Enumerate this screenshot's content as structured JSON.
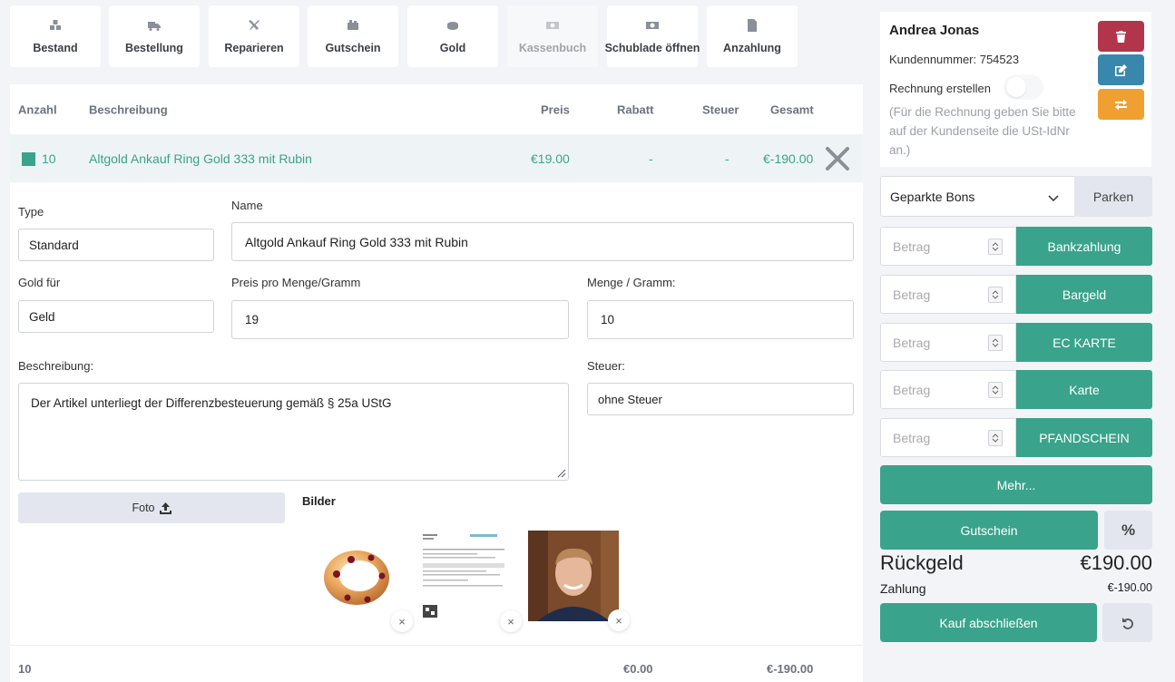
{
  "toolbar": [
    {
      "label": "Bestand",
      "icon": "boxes-icon",
      "disabled": false
    },
    {
      "label": "Bestellung",
      "icon": "truck-icon",
      "disabled": false
    },
    {
      "label": "Reparieren",
      "icon": "tools-icon",
      "disabled": false
    },
    {
      "label": "Gutschein",
      "icon": "voucher-icon",
      "disabled": false
    },
    {
      "label": "Gold",
      "icon": "gold-icon",
      "disabled": false
    },
    {
      "label": "Kassenbuch",
      "icon": "money-icon",
      "disabled": true
    },
    {
      "label": "Schublade öffnen",
      "icon": "money-icon",
      "disabled": false
    },
    {
      "label": "Anzahlung",
      "icon": "invoice-icon",
      "disabled": false
    }
  ],
  "table": {
    "headers": {
      "anzahl": "Anzahl",
      "beschreibung": "Beschreibung",
      "preis": "Preis",
      "rabatt": "Rabatt",
      "steuer": "Steuer",
      "gesamt": "Gesamt"
    },
    "row": {
      "anzahl": "10",
      "beschreibung": "Altgold Ankauf Ring Gold 333 mit Rubin",
      "preis": "€19.00",
      "rabatt": "-",
      "steuer": "-",
      "gesamt": "€-190.00"
    }
  },
  "form": {
    "type_label": "Type",
    "type_value": "Standard",
    "name_label": "Name",
    "name_value": "Altgold Ankauf Ring Gold 333 mit Rubin",
    "goldfuer_label": "Gold für",
    "goldfuer_value": "Geld",
    "preis_label": "Preis pro Menge/Gramm",
    "preis_value": "19",
    "menge_label": "Menge / Gramm:",
    "menge_value": "10",
    "beschreibung_label": "Beschreibung:",
    "beschreibung_value": "Der Artikel unterliegt der Differenzbesteuerung gemäß § 25a UStG",
    "steuer_label": "Steuer:",
    "steuer_value": "ohne Steuer",
    "foto_label": "Foto",
    "bilder_label": "Bilder",
    "remove_symbol": "×"
  },
  "footer": {
    "anzahl": "10",
    "rabatt": "€0.00",
    "gesamt": "€-190.00"
  },
  "customer": {
    "name": "Andrea Jonas",
    "number": "Kundennummer: 754523",
    "rechnung_label": "Rechnung erstellen",
    "note": "(Für die Rechnung geben Sie bitte auf der Kundenseite die USt-IdNr an.)",
    "colors": {
      "delete": "#b3354b",
      "edit": "#3a87ad",
      "switch": "#f0a030"
    }
  },
  "parked": {
    "select_value": "Geparkte Bons",
    "button": "Parken"
  },
  "payments": [
    {
      "placeholder": "Betrag",
      "label": "Bankzahlung"
    },
    {
      "placeholder": "Betrag",
      "label": "Bargeld"
    },
    {
      "placeholder": "Betrag",
      "label": "EC KARTE"
    },
    {
      "placeholder": "Betrag",
      "label": "Karte"
    },
    {
      "placeholder": "Betrag",
      "label": "PFANDSCHEIN"
    }
  ],
  "more_label": "Mehr...",
  "gutschein_label": "Gutschein",
  "percent_symbol": "%",
  "rueckgeld_label": "Rückgeld",
  "rueckgeld_value": "€190.00",
  "zahlung_label": "Zahlung",
  "zahlung_value": "€-190.00",
  "kauf_label": "Kauf abschließen",
  "accent_color": "#3aa38b"
}
